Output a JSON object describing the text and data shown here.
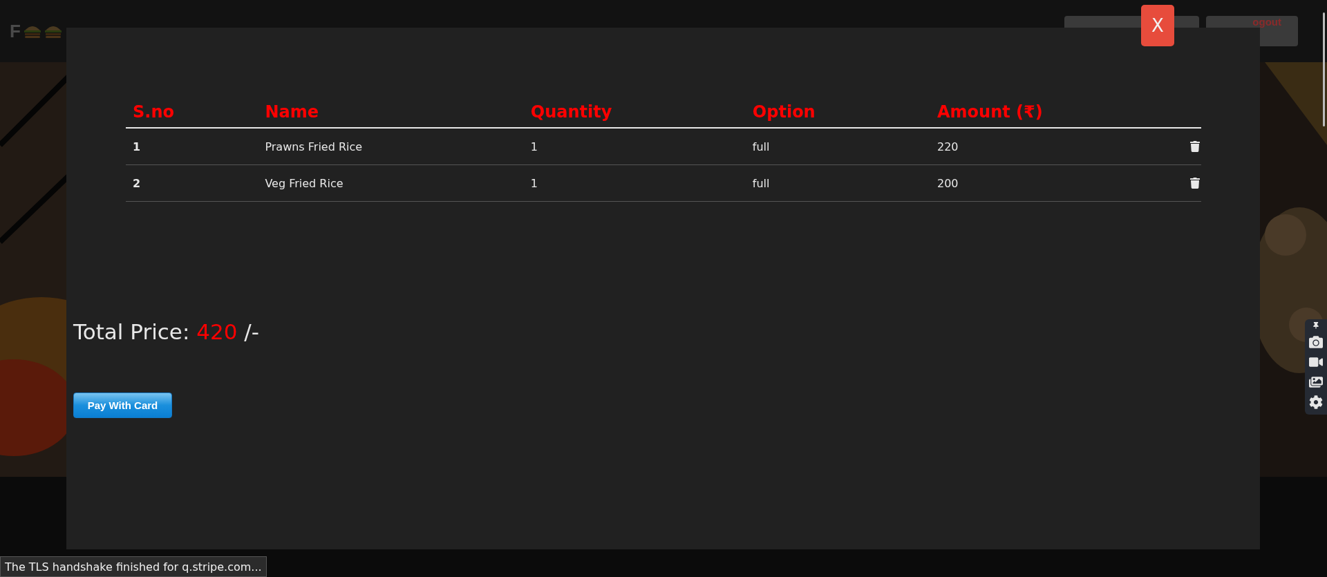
{
  "navbar": {
    "logo": "F",
    "logout_label": "ogout"
  },
  "modal": {
    "close_label": "X",
    "table": {
      "columns": [
        "S.no",
        "Name",
        "Quantity",
        "Option",
        "Amount (₹)"
      ],
      "rows": [
        {
          "sno": "1",
          "name": "Prawns Fried Rice",
          "quantity": "1",
          "option": "full",
          "amount": "220"
        },
        {
          "sno": "2",
          "name": "Veg Fried Rice",
          "quantity": "1",
          "option": "full",
          "amount": "200"
        }
      ]
    },
    "total": {
      "label": "Total Price:",
      "value": "420",
      "suffix": "/-"
    },
    "pay_button": "Pay With Card"
  },
  "status_bar": "The TLS handshake finished for q.stripe.com..."
}
